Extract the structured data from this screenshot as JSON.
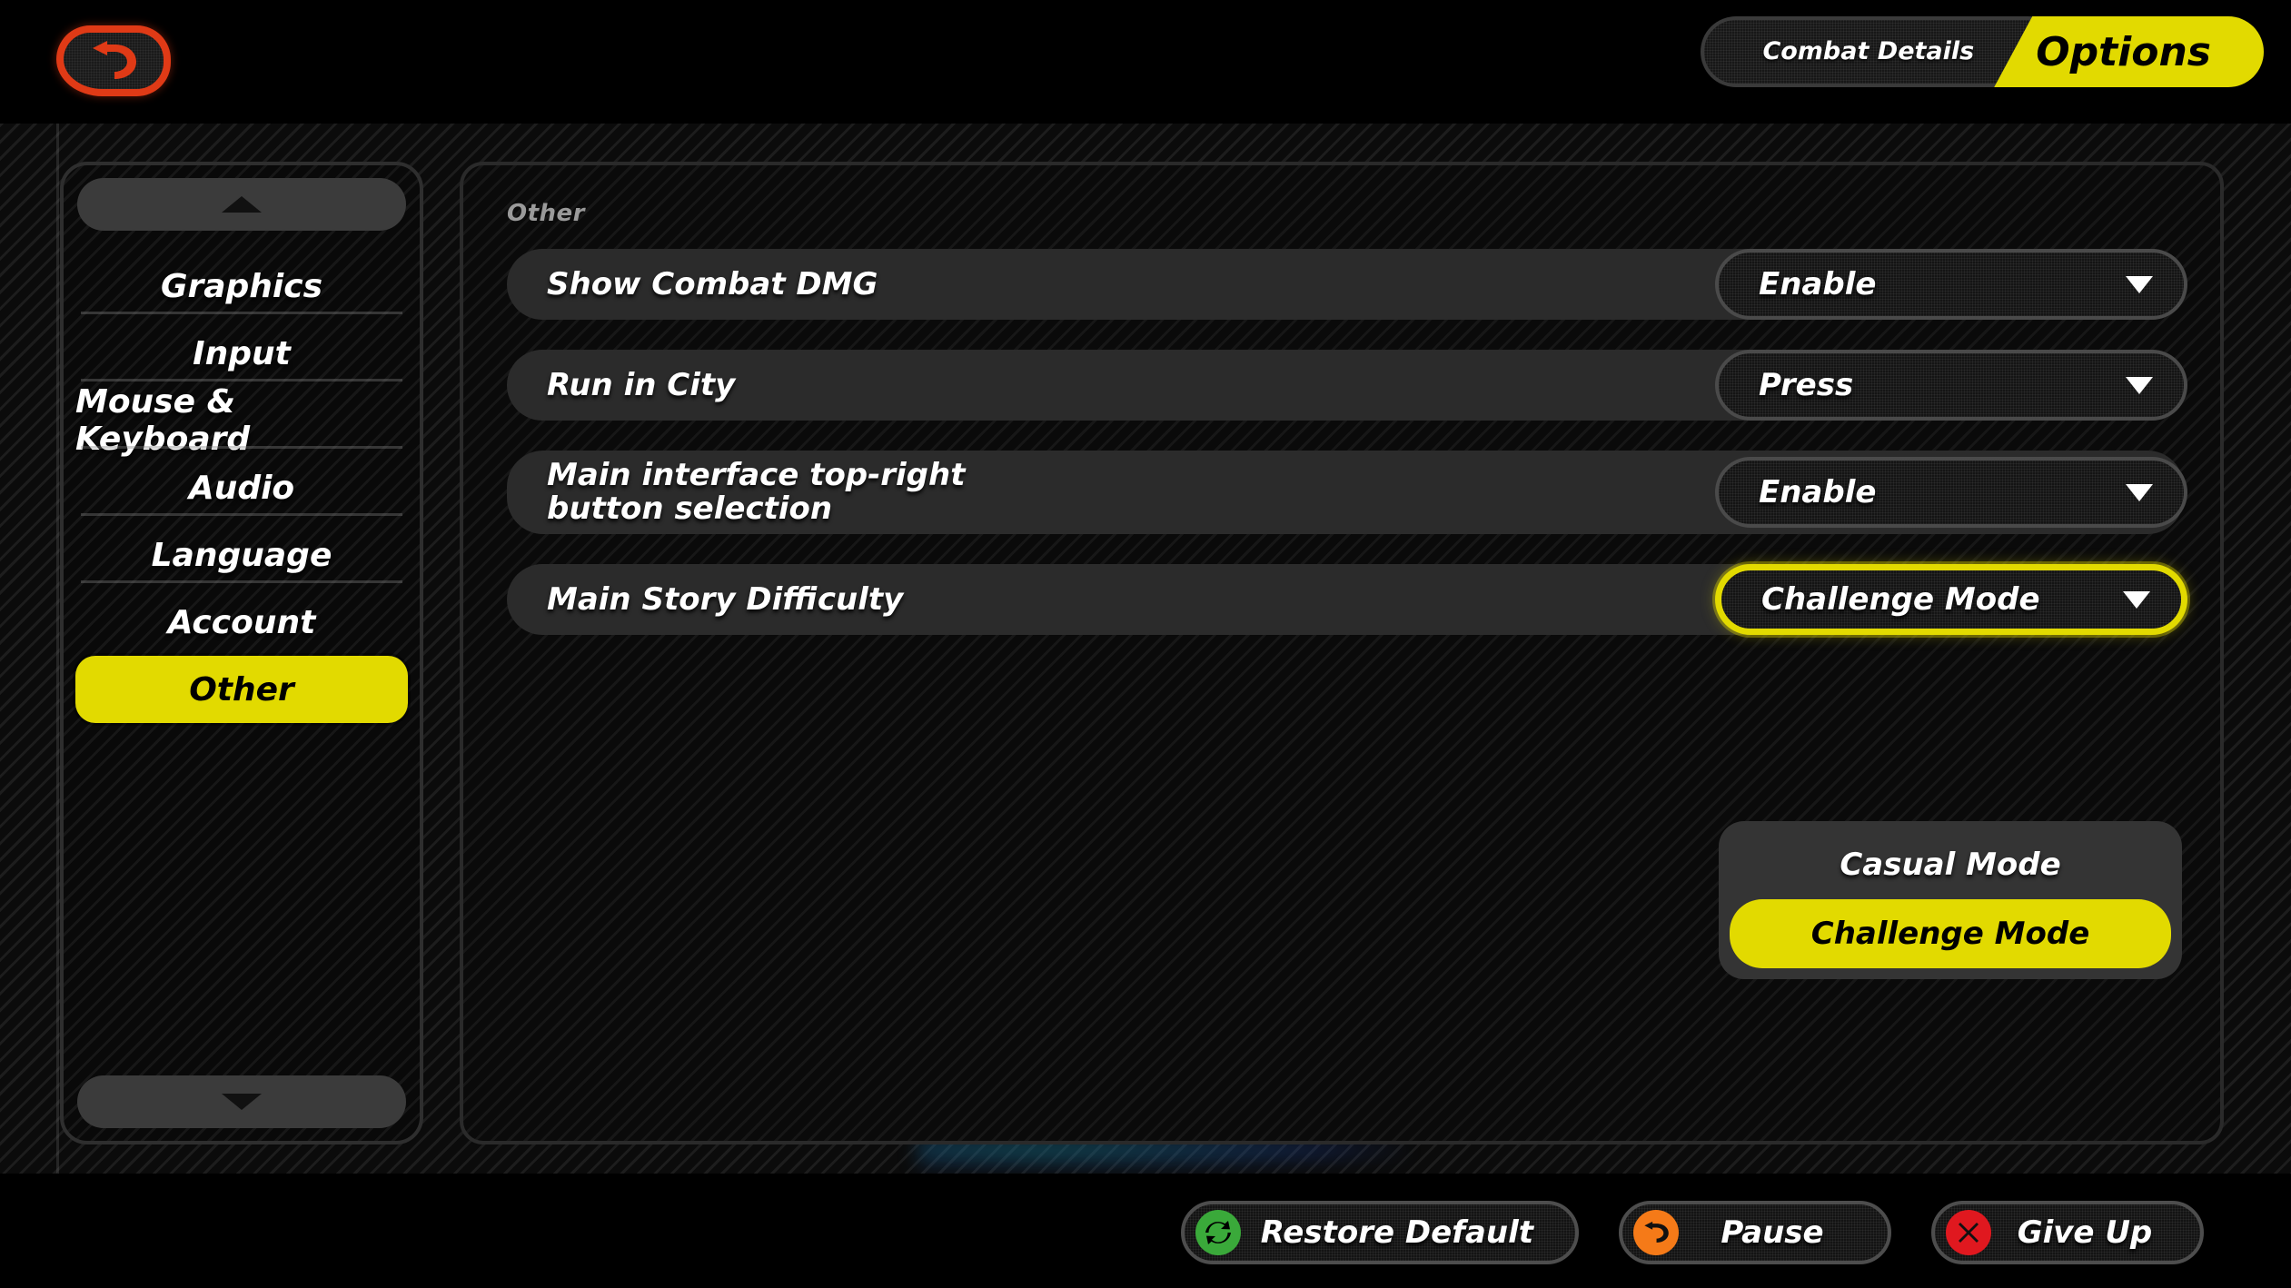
{
  "header": {
    "back_button_icon": "undo-arrow-icon",
    "tabs": [
      {
        "id": "combat-details",
        "label": "Combat\nDetails",
        "active": false
      },
      {
        "id": "options",
        "label": "Options",
        "active": true
      }
    ]
  },
  "sidebar": {
    "scroll_up_icon": "chevron-up-icon",
    "scroll_down_icon": "chevron-down-icon",
    "items": [
      {
        "label": "Graphics",
        "active": false
      },
      {
        "label": "Input",
        "active": false
      },
      {
        "label": "Mouse & Keyboard",
        "active": false
      },
      {
        "label": "Audio",
        "active": false
      },
      {
        "label": "Language",
        "active": false
      },
      {
        "label": "Account",
        "active": false
      },
      {
        "label": "Other",
        "active": true
      }
    ]
  },
  "main": {
    "section_label": "Other",
    "rows": [
      {
        "label": "Show Combat DMG",
        "value": "Enable",
        "open": false
      },
      {
        "label": "Run in City",
        "value": "Press",
        "open": false
      },
      {
        "label": "Main interface top-right\nbutton selection",
        "value": "Enable",
        "open": false
      },
      {
        "label": "Main Story Difficulty",
        "value": "Challenge Mode",
        "open": true
      }
    ],
    "dropdown_menu": {
      "owner": "Main Story Difficulty",
      "options": [
        {
          "label": "Casual Mode",
          "selected": false
        },
        {
          "label": "Challenge Mode",
          "selected": true
        }
      ]
    }
  },
  "footer": {
    "buttons": [
      {
        "label": "Restore Default",
        "icon": "refresh-icon",
        "color": "#3aa93a"
      },
      {
        "label": "Pause",
        "icon": "undo-arrow-icon",
        "color": "#f57a18"
      },
      {
        "label": "Give Up",
        "icon": "close-x-icon",
        "color": "#e0181f"
      }
    ]
  },
  "theme": {
    "accent_yellow": "#e2da00",
    "back_red": "#e03a16",
    "row_bg": "#2b2b2b",
    "menu_bg": "#343434",
    "label_gray": "#9a9a9a"
  }
}
